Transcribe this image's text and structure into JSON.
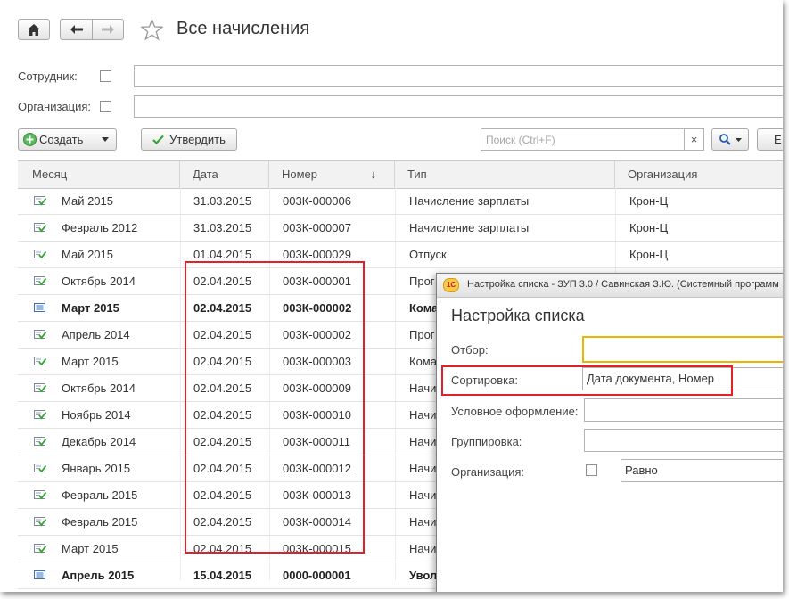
{
  "header": {
    "title": "Все начисления"
  },
  "filters": {
    "employee_label": "Сотрудник:",
    "organization_label": "Организация:"
  },
  "toolbar": {
    "create_label": "Создать",
    "approve_label": "Утвердить",
    "search_placeholder": "Поиск (Ctrl+F)",
    "clear_glyph": "×",
    "extra_button": "Е"
  },
  "table": {
    "columns": [
      "Месяц",
      "Дата",
      "Номер",
      "Тип",
      "Организация"
    ],
    "sort_indicator": "↓",
    "rows": [
      {
        "month": "Май 2015",
        "date": "31.03.2015",
        "number": "003К-000006",
        "type": "Начисление зарплаты",
        "org": "Крон-Ц",
        "bold": false,
        "icon": "posted"
      },
      {
        "month": "Февраль 2012",
        "date": "31.03.2015",
        "number": "003К-000007",
        "type": "Начисление зарплаты",
        "org": "Крон-Ц",
        "bold": false,
        "icon": "posted"
      },
      {
        "month": "Май 2015",
        "date": "01.04.2015",
        "number": "003К-000029",
        "type": "Отпуск",
        "org": "Крон-Ц",
        "bold": false,
        "icon": "posted"
      },
      {
        "month": "Октябрь 2014",
        "date": "02.04.2015",
        "number": "003К-000001",
        "type": "Прог",
        "org": "",
        "bold": false,
        "icon": "posted"
      },
      {
        "month": "Март 2015",
        "date": "02.04.2015",
        "number": "003К-000002",
        "type": "Кома",
        "org": "",
        "bold": true,
        "icon": "draft"
      },
      {
        "month": "Апрель 2014",
        "date": "02.04.2015",
        "number": "003К-000002",
        "type": "Прог",
        "org": "",
        "bold": false,
        "icon": "posted"
      },
      {
        "month": "Март 2015",
        "date": "02.04.2015",
        "number": "003К-000003",
        "type": "Кома",
        "org": "",
        "bold": false,
        "icon": "posted"
      },
      {
        "month": "Октябрь 2014",
        "date": "02.04.2015",
        "number": "003К-000009",
        "type": "Начи",
        "org": "",
        "bold": false,
        "icon": "posted"
      },
      {
        "month": "Ноябрь 2014",
        "date": "02.04.2015",
        "number": "003К-000010",
        "type": "Начи",
        "org": "",
        "bold": false,
        "icon": "posted"
      },
      {
        "month": "Декабрь 2014",
        "date": "02.04.2015",
        "number": "003К-000011",
        "type": "Начи",
        "org": "",
        "bold": false,
        "icon": "posted"
      },
      {
        "month": "Январь 2015",
        "date": "02.04.2015",
        "number": "003К-000012",
        "type": "Начи",
        "org": "",
        "bold": false,
        "icon": "posted"
      },
      {
        "month": "Февраль 2015",
        "date": "02.04.2015",
        "number": "003К-000013",
        "type": "Начи",
        "org": "",
        "bold": false,
        "icon": "posted"
      },
      {
        "month": "Февраль 2015",
        "date": "02.04.2015",
        "number": "003К-000014",
        "type": "Начи",
        "org": "",
        "bold": false,
        "icon": "posted"
      },
      {
        "month": "Март 2015",
        "date": "02.04.2015",
        "number": "003К-000015",
        "type": "Начи",
        "org": "",
        "bold": false,
        "icon": "posted"
      },
      {
        "month": "Апрель 2015",
        "date": "15.04.2015",
        "number": "0000-000001",
        "type": "Увол",
        "org": "",
        "bold": true,
        "icon": "draft"
      }
    ]
  },
  "dialog": {
    "window_title": "Настройка списка - ЗУП 3.0 / Савинская З.Ю. (Системный программ",
    "logo_text": "1С",
    "heading": "Настройка списка",
    "filter_label": "Отбор:",
    "sort_label": "Сортировка:",
    "sort_value": "Дата документа, Номер",
    "conditional_label": "Условное оформление:",
    "grouping_label": "Группировка:",
    "organization_label": "Организация:",
    "organization_condition": "Равно"
  },
  "colors": {
    "highlight_red": "#e3202a",
    "posted_icon_green": "#3aa335",
    "filter_field_border": "#f0b400"
  }
}
